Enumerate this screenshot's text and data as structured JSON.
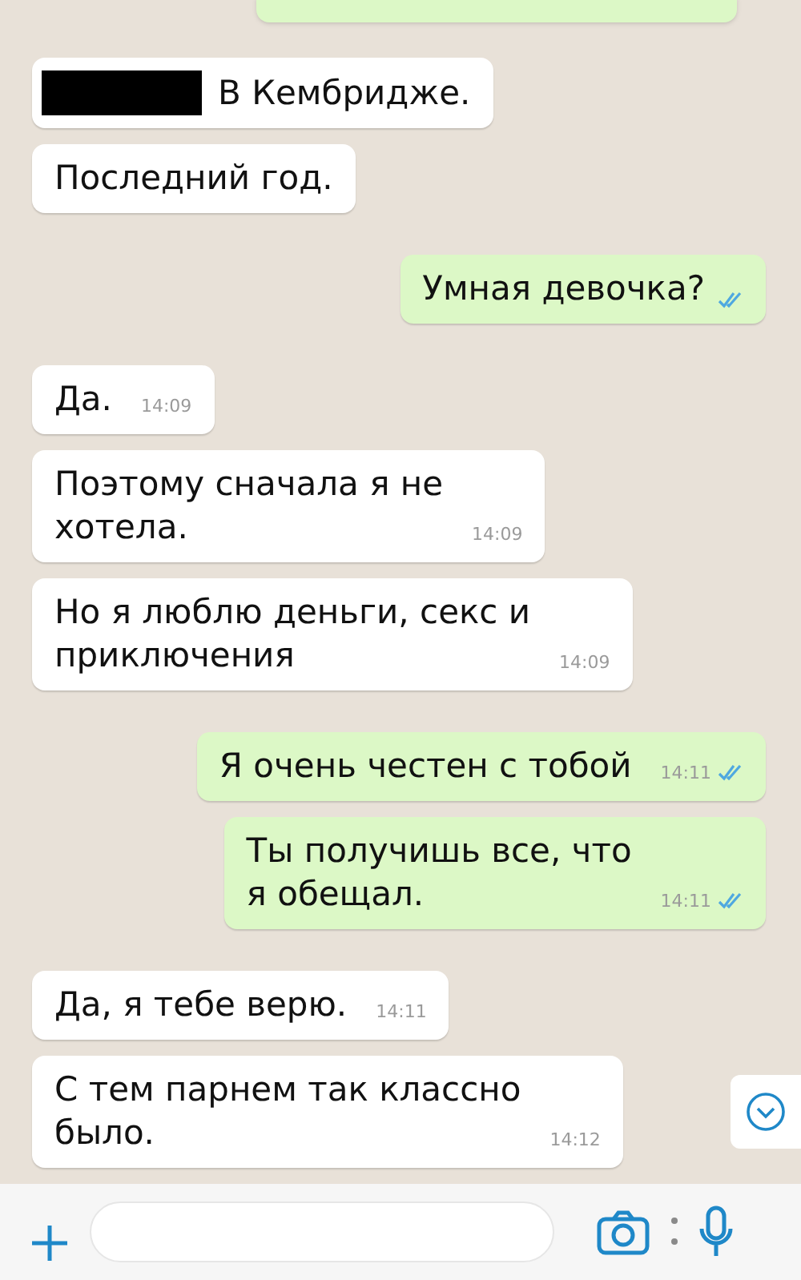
{
  "messages": [
    {
      "kind": "incoming",
      "redacted": true,
      "text": "В Кембридже."
    },
    {
      "kind": "incoming",
      "text": "Последний год."
    },
    {
      "kind": "outgoing",
      "text": "Умная девочка?",
      "read": true
    },
    {
      "kind": "incoming",
      "text": "Да.",
      "time": "14:09"
    },
    {
      "kind": "incoming",
      "text": "Поэтому сначала я не\nхотела.",
      "time": "14:09"
    },
    {
      "kind": "incoming",
      "text": "Но я люблю деньги, секс и\nприключения",
      "time": "14:09"
    },
    {
      "kind": "outgoing",
      "text": "Я очень честен с тобой",
      "time": "14:11",
      "read": true
    },
    {
      "kind": "outgoing",
      "text": "Ты получишь все, что\nя обещал.",
      "time": "14:11",
      "read": true
    },
    {
      "kind": "incoming",
      "text": "Да, я тебе верю.",
      "time": "14:11"
    },
    {
      "kind": "incoming",
      "text": "С тем парнем так классно\nбыло.",
      "time": "14:12"
    }
  ]
}
